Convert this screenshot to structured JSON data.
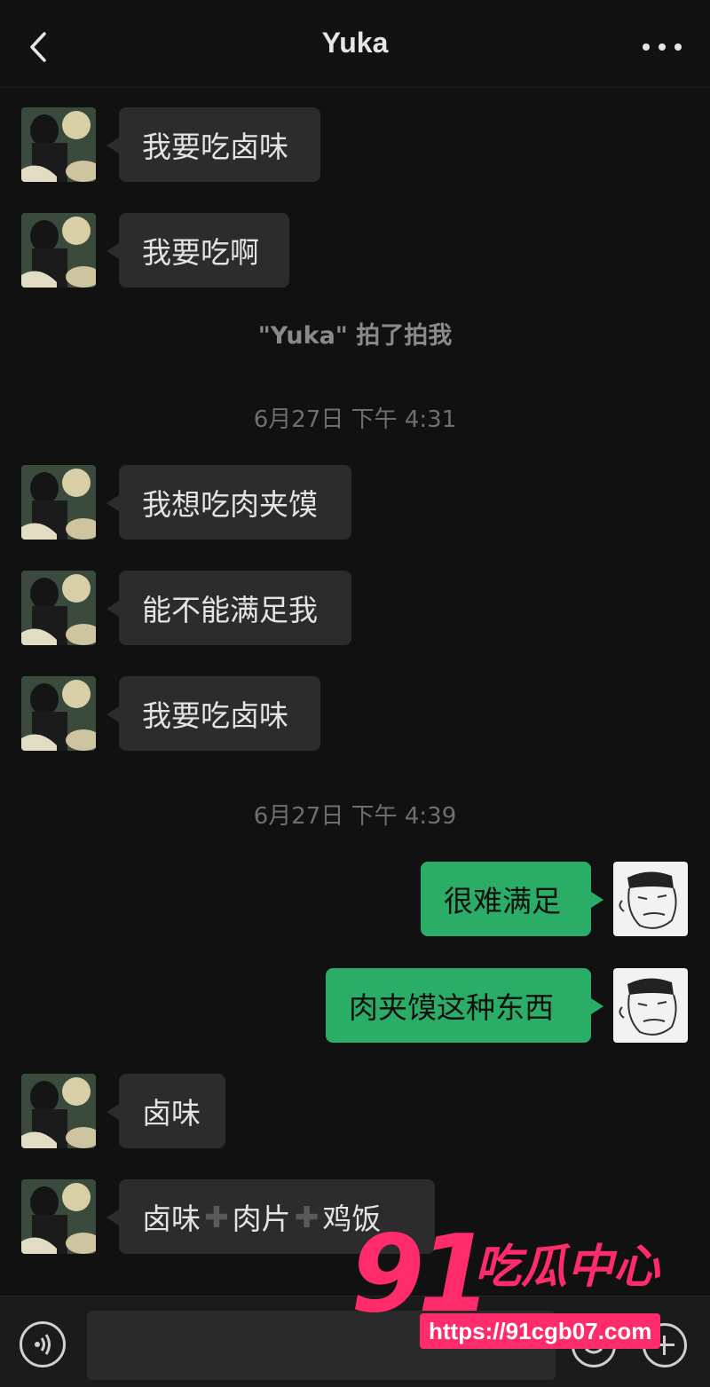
{
  "header": {
    "title": "Yuka",
    "back_icon": "chevron-left-icon",
    "more_icon": "ellipsis-icon"
  },
  "messages": [
    {
      "side": "in",
      "text": "我要吃卤味"
    },
    {
      "side": "in",
      "text": "我要吃啊"
    },
    {
      "type": "system",
      "text": "\"Yuka\" 拍了拍我"
    },
    {
      "type": "timestamp",
      "text": "6月27日 下午 4:31"
    },
    {
      "side": "in",
      "text": "我想吃肉夹馍"
    },
    {
      "side": "in",
      "text": "能不能满足我"
    },
    {
      "side": "in",
      "text": "我要吃卤味"
    },
    {
      "type": "timestamp",
      "text": "6月27日 下午 4:39"
    },
    {
      "side": "out",
      "text": "很难满足"
    },
    {
      "side": "out",
      "text": "肉夹馍这种东西"
    },
    {
      "side": "in",
      "text": "卤味"
    },
    {
      "side": "in",
      "parts": [
        "卤味",
        "肉片",
        "鸡饭"
      ],
      "separator": "plus-icon"
    }
  ],
  "input_bar": {
    "voice_icon": "voice-icon",
    "emoji_icon": "emoji-icon",
    "add_icon": "plus-circle-icon"
  },
  "watermark": {
    "number": "91",
    "text": "吃瓜中心",
    "url": "https://91cgb07.com"
  },
  "colors": {
    "background": "#111111",
    "incoming_bubble": "#2c2c2c",
    "outgoing_bubble": "#2aae67",
    "watermark": "#ff2b6b"
  }
}
